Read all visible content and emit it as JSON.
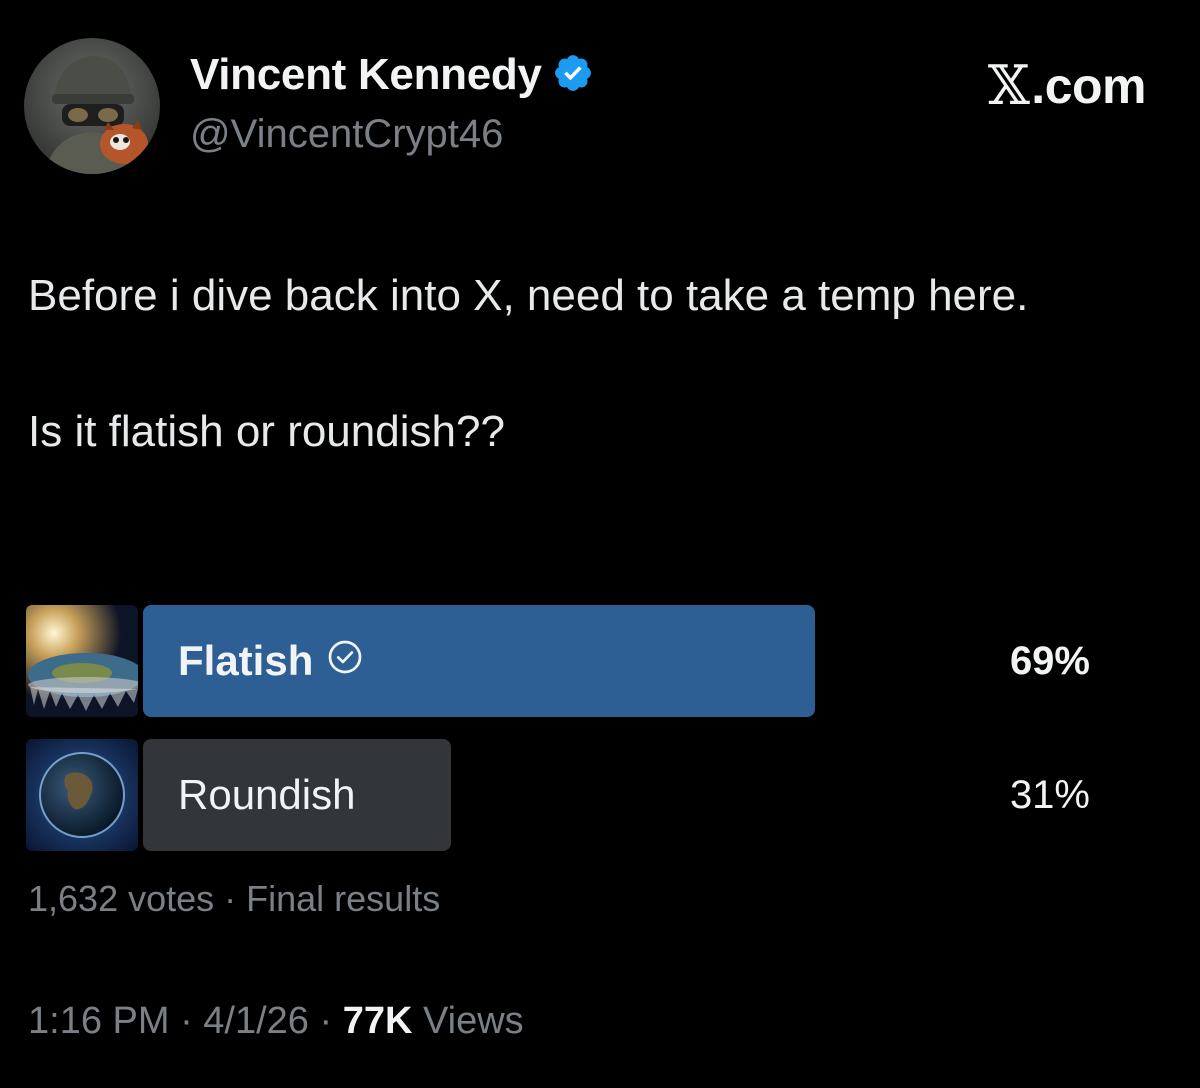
{
  "author": {
    "display_name": "Vincent Kennedy",
    "handle": "@VincentCrypt46",
    "verified_icon": "verified-badge-icon",
    "avatar_icon": "avatar-soldier-with-red-panda"
  },
  "brand": {
    "glyph": "𝕏",
    "label": ".com"
  },
  "tweet": {
    "paragraphs": [
      "Before i dive back into X, need to take a temp here.",
      "Is it flatish or roundish??"
    ]
  },
  "poll": {
    "options": [
      {
        "label": "Flatish",
        "percent_label": "69%",
        "percent": 69,
        "winner": true,
        "bar_color": "#2d5f94",
        "thumbnail_icon": "flat-earth-image"
      },
      {
        "label": "Roundish",
        "percent_label": "31%",
        "percent": 31,
        "winner": false,
        "bar_color": "#333639",
        "thumbnail_icon": "globe-earth-image"
      }
    ],
    "meta": "1,632 votes · Final results"
  },
  "footer": {
    "time_date": "1:16 PM · 4/1/26 · ",
    "views_count": "77K",
    "views_label": " Views"
  },
  "colors": {
    "background": "#000000",
    "text_primary": "#e7e9ea",
    "text_secondary": "#7a8086",
    "verified_blue": "#1d9bf0",
    "winner_bar": "#2d5f94",
    "loser_bar": "#333639"
  }
}
